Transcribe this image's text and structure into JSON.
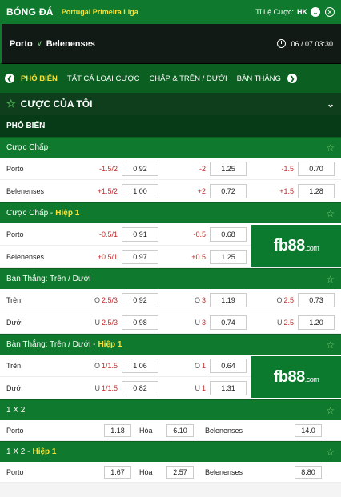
{
  "topbar": {
    "title": "BÓNG ĐÁ",
    "league": "Portugal Primeira Liga",
    "odds_label": "Tỉ Lệ Cược:",
    "odds_format": "HK"
  },
  "match": {
    "home": "Porto",
    "vs": "v",
    "away": "Belenenses",
    "datetime": "06 / 07  03:30"
  },
  "tabs": [
    "PHỔ BIẾN",
    "TẤT CẢ LOẠI CƯỢC",
    "CHẤP & TRÊN / DƯỚI",
    "BÀN THẮNG"
  ],
  "my_bets": "CƯỢC CỦA TÔI",
  "popular": "PHỔ BIẾN",
  "banner": {
    "brand": "fb88",
    "tld": ".com"
  },
  "sections": {
    "hcap": {
      "title": "Cược Chấp",
      "rows": [
        {
          "name": "Porto",
          "l1": "-1.5/2",
          "o1": "0.92",
          "l2": "-2",
          "o2": "1.25",
          "l3": "-1.5",
          "o3": "0.70"
        },
        {
          "name": "Belenenses",
          "l1": "+1.5/2",
          "o1": "1.00",
          "l2": "+2",
          "o2": "0.72",
          "l3": "+1.5",
          "o3": "1.28"
        }
      ]
    },
    "hcap_h1": {
      "title": "Cược Chấp -",
      "half": "Hiệp 1",
      "rows": [
        {
          "name": "Porto",
          "l1": "-0.5/1",
          "o1": "0.91",
          "l2": "-0.5",
          "o2": "0.68"
        },
        {
          "name": "Belenenses",
          "l1": "+0.5/1",
          "o1": "0.97",
          "l2": "+0.5",
          "o2": "1.25"
        }
      ]
    },
    "ou": {
      "title": "Bàn Thắng: Trên / Dưới",
      "rows": [
        {
          "name": "Trên",
          "p": "O",
          "l1": "2.5/3",
          "o1": "0.92",
          "l2": "3",
          "o2": "1.19",
          "l3": "2.5",
          "o3": "0.73"
        },
        {
          "name": "Dưới",
          "p": "U",
          "l1": "2.5/3",
          "o1": "0.98",
          "l2": "3",
          "o2": "0.74",
          "l3": "2.5",
          "o3": "1.20"
        }
      ]
    },
    "ou_h1": {
      "title": "Bàn Thắng: Trên / Dưới -",
      "half": "Hiệp 1",
      "rows": [
        {
          "name": "Trên",
          "p": "O",
          "l1": "1/1.5",
          "o1": "1.06",
          "l2": "1",
          "o2": "0.64"
        },
        {
          "name": "Dưới",
          "p": "U",
          "l1": "1/1.5",
          "o1": "0.82",
          "l2": "1",
          "o2": "1.31"
        }
      ]
    },
    "x12": {
      "title": "1 X 2",
      "home": "Porto",
      "home_odd": "1.18",
      "draw": "Hòa",
      "draw_odd": "6.10",
      "away": "Belenenses",
      "away_odd": "14.0"
    },
    "x12_h1": {
      "title": "1 X 2 -",
      "half": "Hiệp 1",
      "home": "Porto",
      "home_odd": "1.67",
      "draw": "Hòa",
      "draw_odd": "2.57",
      "away": "Belenenses",
      "away_odd": "8.80"
    }
  },
  "colors": {
    "green": "#0f7a2d",
    "dark": "#073a17",
    "yellow": "#f7e13a",
    "red": "#c62828"
  }
}
